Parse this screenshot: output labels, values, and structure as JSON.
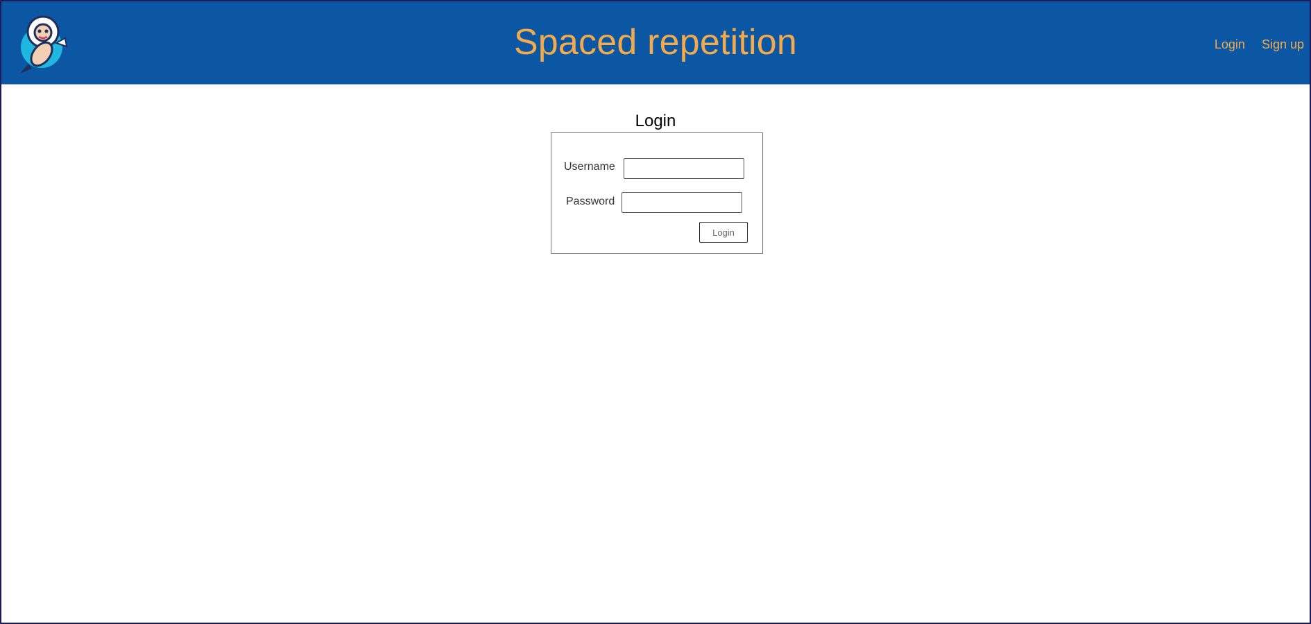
{
  "header": {
    "title": "Spaced repetition",
    "logo_icon": "astronaut-rocket-icon",
    "nav": {
      "login": "Login",
      "signup": "Sign up"
    }
  },
  "main": {
    "title": "Login",
    "form": {
      "username_label": "Username",
      "username_value": "",
      "password_label": "Password",
      "password_value": "",
      "submit_label": "Login"
    }
  },
  "colors": {
    "header_bg": "#0b57a4",
    "accent": "#f2aa4c",
    "frame_border": "#1c1c5c"
  }
}
